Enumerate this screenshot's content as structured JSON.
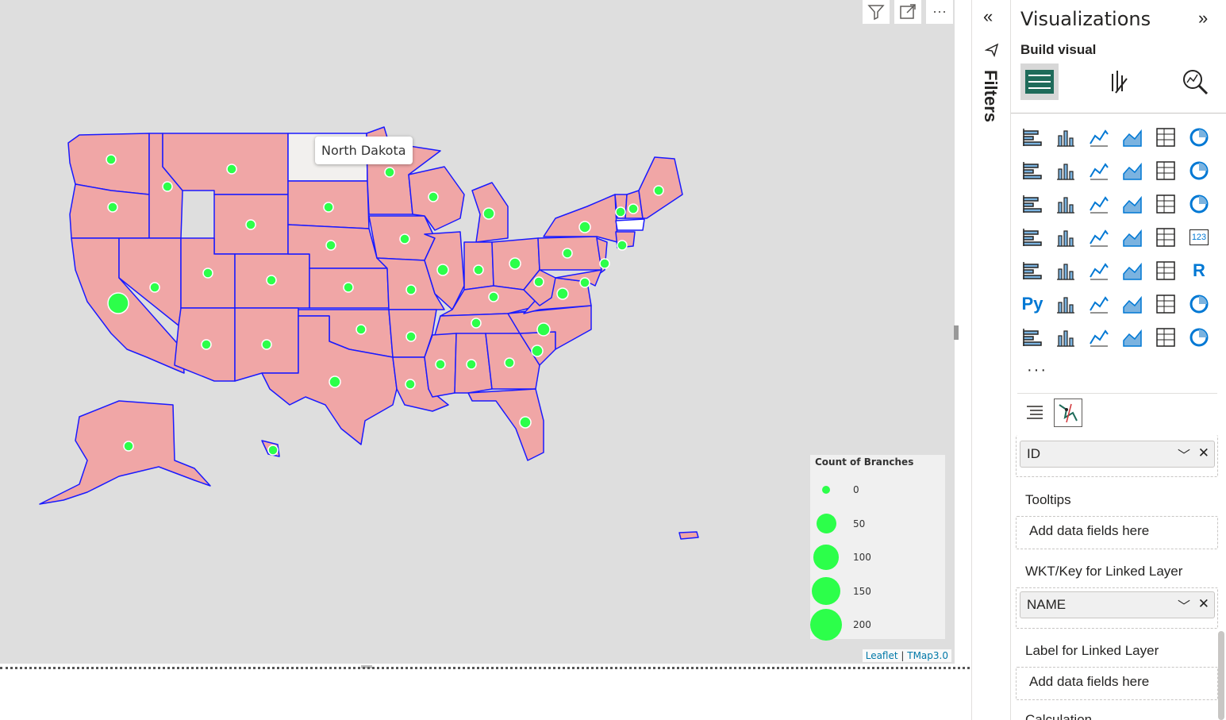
{
  "visual_header": {
    "filter_icon": "filter-icon",
    "focus_icon": "focus-mode-icon",
    "more_label": "⋯"
  },
  "map": {
    "tooltip": "North Dakota",
    "state_fill": "#f0a6a6",
    "state_stroke": "#1a1aff",
    "highlight_fill": "#f2f0ee",
    "bubble_color": "#2cff4a",
    "legend": {
      "title": "Count of Branches",
      "entries": [
        {
          "label": "0",
          "value": 0
        },
        {
          "label": "50",
          "value": 50
        },
        {
          "label": "100",
          "value": 100
        },
        {
          "label": "150",
          "value": 150
        },
        {
          "label": "200",
          "value": 200
        }
      ]
    },
    "attribution": {
      "leaflet": "Leaflet",
      "separator": " | ",
      "tmap": "TMap3.0"
    }
  },
  "filters": {
    "label": "Filters",
    "collapse_icon": "double-chevron-left-icon"
  },
  "viz": {
    "title": "Visualizations",
    "expand_icon": "double-chevron-right-icon",
    "build_visual": "Build visual",
    "more": "···",
    "wells": {
      "id_pill": "ID",
      "tooltips_label": "Tooltips",
      "tooltips_placeholder": "Add data fields here",
      "wkt_label": "WKT/Key for Linked Layer",
      "name_pill": "NAME",
      "label_linked": "Label for Linked Layer",
      "label_placeholder": "Add data fields here",
      "next_label": "Calculation"
    },
    "py_label": "Py",
    "r_label": "R",
    "num_label": "123"
  }
}
